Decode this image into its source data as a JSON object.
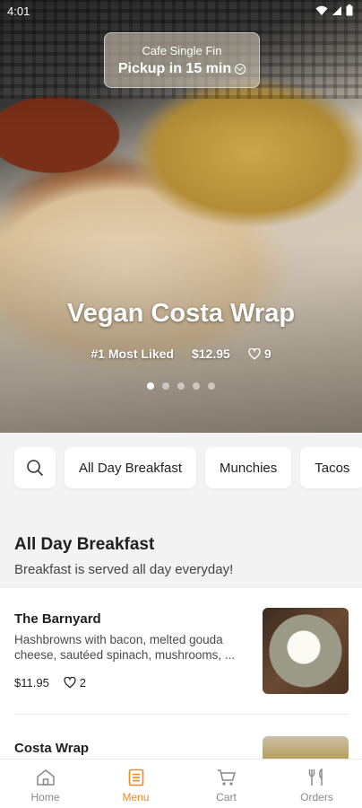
{
  "status": {
    "time": "4:01"
  },
  "hero": {
    "pickup_location": "Cafe Single Fin",
    "pickup_time": "Pickup in 15 min",
    "title": "Vegan Costa Wrap",
    "tag": "#1 Most Liked",
    "price": "$12.95",
    "likes": "9",
    "dots_total": 5,
    "dots_active": 0
  },
  "categories": [
    {
      "label": "All Day Breakfast"
    },
    {
      "label": "Munchies"
    },
    {
      "label": "Tacos"
    }
  ],
  "section": {
    "title": "All Day Breakfast",
    "subtitle": "Breakfast is served all day everyday!"
  },
  "items": [
    {
      "name": "The Barnyard",
      "description": "Hashbrowns with bacon, melted gouda cheese, sautéed spinach, mushrooms, ...",
      "price": "$11.95",
      "likes": "2"
    },
    {
      "name": "Costa Wrap"
    }
  ],
  "nav": [
    {
      "label": "Home",
      "icon": "home-icon"
    },
    {
      "label": "Menu",
      "icon": "menu-icon"
    },
    {
      "label": "Cart",
      "icon": "cart-icon"
    },
    {
      "label": "Orders",
      "icon": "orders-icon"
    }
  ],
  "colors": {
    "accent": "#f08a24",
    "inactive": "#8a8a8a"
  }
}
